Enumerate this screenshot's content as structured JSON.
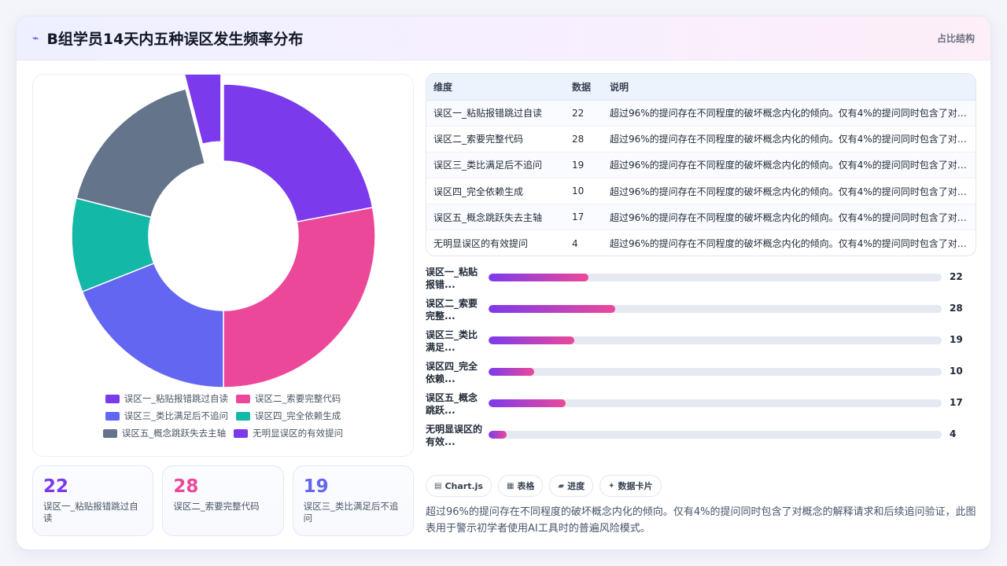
{
  "header": {
    "title": "B组学员14天内五种误区发生频率分布",
    "tag": "占比结构",
    "icon": "sparkle-icon"
  },
  "chart_data": {
    "type": "pie",
    "categories": [
      "误区一_粘贴报错跳过自读",
      "误区二_索要完整代码",
      "误区三_类比满足后不追问",
      "误区四_完全依赖生成",
      "误区五_概念跳跃失去主轴",
      "无明显误区的有效提问"
    ],
    "values": [
      22,
      28,
      19,
      10,
      17,
      4
    ],
    "colors": [
      "#7c3aed",
      "#ec4899",
      "#6366f1",
      "#14b8a6",
      "#64748b",
      "#7c3aed"
    ],
    "donut": true,
    "explode_index": 5
  },
  "stats": [
    {
      "value": "22",
      "label": "误区一_粘贴报错跳过自读",
      "color": "#7c3aed"
    },
    {
      "value": "28",
      "label": "误区二_索要完整代码",
      "color": "#ec4899"
    },
    {
      "value": "19",
      "label": "误区三_类比满足后不追问",
      "color": "#6366f1"
    }
  ],
  "table": {
    "headers": [
      "维度",
      "数据",
      "说明"
    ],
    "rows": [
      [
        "误区一_粘贴报错跳过自读",
        "22",
        "超过96%的提问存在不同程度的破坏概念内化的倾向。仅有4%的提问同时包含了对概念的解释请求和后续追问验证，此图表用于警示初学者使用AI工具时的普遍风险模式。"
      ],
      [
        "误区二_索要完整代码",
        "28",
        "超过96%的提问存在不同程度的破坏概念内化的倾向。仅有4%的提问同时包含了对概念的解释请求和后续追问验证，此图表用于警示初学者使用AI工具时的普遍风险模式。"
      ],
      [
        "误区三_类比满足后不追问",
        "19",
        "超过96%的提问存在不同程度的破坏概念内化的倾向。仅有4%的提问同时包含了对概念的解释请求和后续追问验证，此图表用于警示初学者使用AI工具时的普遍风险模式。"
      ],
      [
        "误区四_完全依赖生成",
        "10",
        "超过96%的提问存在不同程度的破坏概念内化的倾向。仅有4%的提问同时包含了对概念的解释请求和后续追问验证，此图表用于警示初学者使用AI工具时的普遍风险模式。"
      ],
      [
        "误区五_概念跳跃失去主轴",
        "17",
        "超过96%的提问存在不同程度的破坏概念内化的倾向。仅有4%的提问同时包含了对概念的解释请求和后续追问验证，此图表用于警示初学者使用AI工具时的普遍风险模式。"
      ],
      [
        "无明显误区的有效提问",
        "4",
        "超过96%的提问存在不同程度的破坏概念内化的倾向。仅有4%的提问同时包含了对概念的解释请求和后续追问验证，此图表用于警示初学者使用AI工具时的普遍风险模式。"
      ]
    ]
  },
  "bars": [
    {
      "label": "误区一_粘贴报错...",
      "value": 22
    },
    {
      "label": "误区二_索要完整...",
      "value": 28
    },
    {
      "label": "误区三_类比满足...",
      "value": 19
    },
    {
      "label": "误区四_完全依赖...",
      "value": 10
    },
    {
      "label": "误区五_概念跳跃...",
      "value": 17
    },
    {
      "label": "无明显误区的有效...",
      "value": 4
    }
  ],
  "bars_max": 100,
  "chips": [
    {
      "icon": "chart-icon",
      "glyph": "▤",
      "label": "Chart.js"
    },
    {
      "icon": "table-icon",
      "glyph": "▦",
      "label": "表格"
    },
    {
      "icon": "progress-icon",
      "glyph": "▰",
      "label": "进度"
    },
    {
      "icon": "card-icon",
      "glyph": "✦",
      "label": "数据卡片"
    }
  ],
  "description": "超过96%的提问存在不同程度的破坏概念内化的倾向。仅有4%的提问同时包含了对概念的解释请求和后续追问验证，此图表用于警示初学者使用AI工具时的普遍风险模式。"
}
